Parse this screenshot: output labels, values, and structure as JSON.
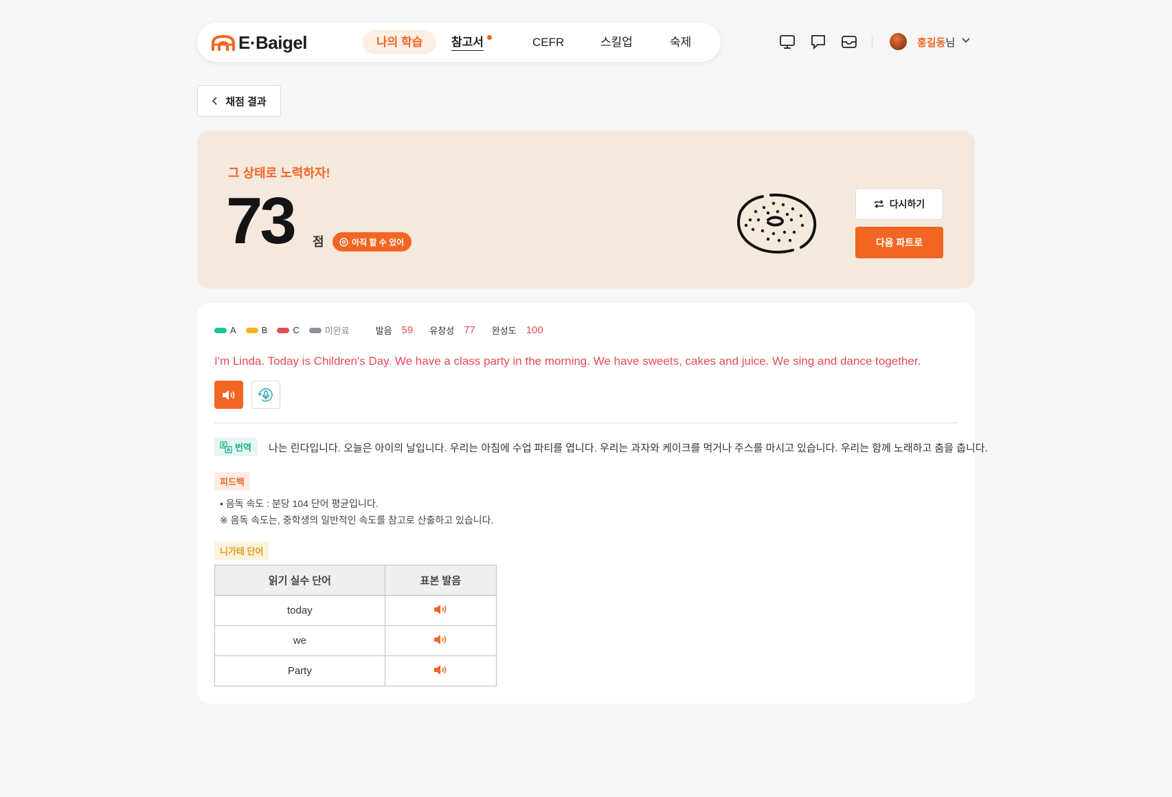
{
  "brand": {
    "name": "E·Baigel",
    "accent": "#f26522"
  },
  "nav": {
    "items": [
      {
        "label": "나의 학습",
        "state": "active"
      },
      {
        "label": "참고서",
        "state": "new"
      },
      {
        "label": "CEFR",
        "state": "normal"
      },
      {
        "label": "스킬업",
        "state": "normal"
      },
      {
        "label": "숙제",
        "state": "normal"
      }
    ]
  },
  "header": {
    "icons": [
      "monitor-icon",
      "chat-icon",
      "mail-icon"
    ],
    "user": {
      "name": "홍길동",
      "suffix": "님"
    }
  },
  "back": {
    "label": "채점 결과"
  },
  "score_card": {
    "encourage": "그 상태로 노력하자!",
    "score": "73",
    "unit": "점",
    "badge": "아직 할 수 있어",
    "retry_label": "다시하기",
    "next_label": "다음 파트로"
  },
  "result": {
    "legend": [
      {
        "label": "A",
        "color": "#1fc49b"
      },
      {
        "label": "B",
        "color": "#f6b21c"
      },
      {
        "label": "C",
        "color": "#e9495a"
      },
      {
        "label": "미완료",
        "color": "#8b9099"
      }
    ],
    "metrics": [
      {
        "label": "발음",
        "value": "59"
      },
      {
        "label": "유창성",
        "value": "77"
      },
      {
        "label": "완성도",
        "value": "100"
      }
    ],
    "sentence": "I'm Linda. Today is Children's Day. We have a class party in the morning. We have sweets, cakes and juice. We sing and dance together.",
    "translation_tag": "번역",
    "translation": "나는 린다입니다. 오늘은 아이의 날입니다. 우리는 아침에 수업 파티를 엽니다. 우리는 과자와 케이크를 먹거나 주스를 마시고 있습니다. 우리는 함께 노래하고 춤을 춥니다.",
    "feedback_tag": "피드백",
    "feedback_line1": "•  음독 속도 : 분당 104 단어 평균입니다.",
    "feedback_line2": "※ 음독 속도는, 중학생의 일반적인 속도를 참고로 산출하고 있습니다.",
    "negative_tag": "니가테 단어",
    "table": {
      "headers": [
        "읽기 실수 단어",
        "표본 발음"
      ],
      "rows": [
        "today",
        "we",
        "Party"
      ]
    }
  }
}
